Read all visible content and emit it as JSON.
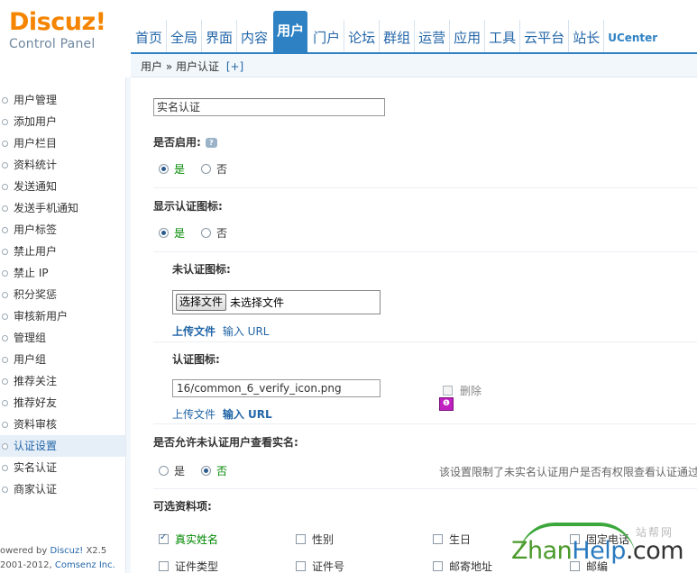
{
  "logo": {
    "brand": "Discuz!",
    "subtitle": "Control Panel"
  },
  "nav": {
    "tabs": [
      "首页",
      "全局",
      "界面",
      "内容",
      "用户",
      "门户",
      "论坛",
      "群组",
      "运营",
      "应用",
      "工具",
      "云平台",
      "站长",
      "UCenter"
    ],
    "active_index": 4
  },
  "breadcrumb": {
    "text": "用户 » 用户认证",
    "add": "[+]"
  },
  "sidebar": {
    "items": [
      "用户管理",
      "添加用户",
      "用户栏目",
      "资料统计",
      "发送通知",
      "发送手机通知",
      "用户标签",
      "禁止用户",
      "禁止 IP",
      "积分奖惩",
      "审核新用户",
      "管理组",
      "用户组",
      "推荐关注",
      "推荐好友",
      "资料审核",
      "认证设置",
      "实名认证",
      "商家认证"
    ],
    "active_index": 16
  },
  "footer": {
    "line1_prefix": "owered by ",
    "line1_link": "Discuz!",
    "line1_suffix": " X2.5",
    "line2_prefix": "2001-2012, ",
    "line2_link": "Comsenz Inc."
  },
  "form": {
    "name_value": "实名认证",
    "enable": {
      "label": "是否启用:",
      "yes": "是",
      "no": "否",
      "value": "yes"
    },
    "show_icon": {
      "label": "显示认证图标:",
      "yes": "是",
      "no": "否",
      "value": "yes"
    },
    "unverified_icon": {
      "label": "未认证图标:",
      "button": "选择文件",
      "status": "未选择文件",
      "upload": "上传文件",
      "input_url": "输入 URL"
    },
    "verified_icon": {
      "label": "认证图标:",
      "path": "16/common_6_verify_icon.png",
      "upload": "上传文件",
      "input_url": "输入 URL",
      "delete": "删除",
      "icon_glyph": "❶"
    },
    "allow_view": {
      "label": "是否允许未认证用户查看实名:",
      "yes": "是",
      "no": "否",
      "value": "no",
      "tip": "该设置限制了未实名认证用户是否有权限查看认证通过"
    },
    "optional_fields": {
      "label": "可选资料项:",
      "items": [
        {
          "text": "真实姓名",
          "checked": true
        },
        {
          "text": "性别",
          "checked": false
        },
        {
          "text": "生日",
          "checked": false
        },
        {
          "text": "固定电话",
          "checked": false
        },
        {
          "text": "证件类型",
          "checked": false
        },
        {
          "text": "证件号",
          "checked": false
        },
        {
          "text": "邮寄地址",
          "checked": false
        },
        {
          "text": "邮编",
          "checked": false
        }
      ]
    }
  },
  "watermark": {
    "text_a": "Zhan",
    "text_b": "Help",
    "text_c": ".com",
    "cn": "站帮网"
  },
  "colors": {
    "accent": "#2e82c4",
    "brand": "#f58400",
    "link": "#2366a8",
    "green": "#008800"
  }
}
